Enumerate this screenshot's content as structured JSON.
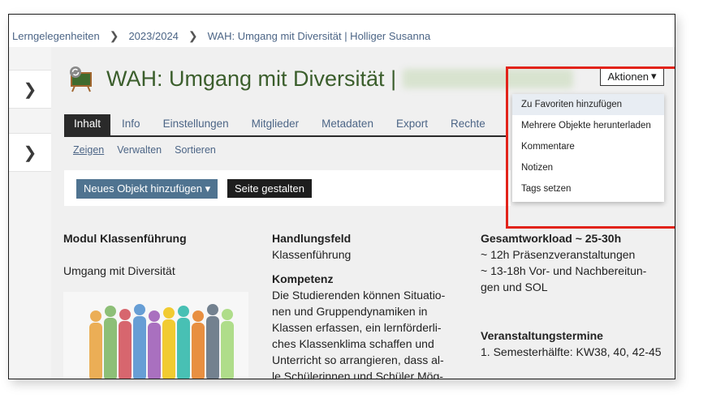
{
  "breadcrumb": {
    "items": [
      "Lerngelegenheiten",
      "2023/2024",
      "WAH: Umgang mit Diversität | Holliger Susanna"
    ]
  },
  "header": {
    "title": "WAH: Umgang mit Diversität |",
    "actions_label": "Aktionen"
  },
  "tabs": [
    "Inhalt",
    "Info",
    "Einstellungen",
    "Mitglieder",
    "Metadaten",
    "Export",
    "Rechte"
  ],
  "subtabs": [
    "Zeigen",
    "Verwalten",
    "Sortieren"
  ],
  "toolbar": {
    "add_object": "Neues Objekt hinzufügen",
    "design_page": "Seite gestalten"
  },
  "actions_menu": {
    "items": [
      "Zu Favoriten hinzufügen",
      "Mehrere Objekte herunterladen",
      "Kommentare",
      "Notizen",
      "Tags setzen"
    ]
  },
  "content": {
    "col1": {
      "heading": "Modul Klassenführung",
      "text": "Umgang mit Diversität"
    },
    "col2": {
      "heading1": "Handlungsfeld",
      "text1": "Klassenführung",
      "heading2": "Kompetenz",
      "lines": [
        "Die Studierenden können Situatio-",
        "nen und Gruppendynamiken in",
        "Klassen erfassen, ein lernförderli-",
        "ches Klassenklima schaffen und",
        "Unterricht so arrangieren, dass al-",
        "le Schülerinnen und Schüler Mög-"
      ]
    },
    "col3": {
      "heading1": "Gesamtworkload ~ 25-30h",
      "lines1": [
        "~ 12h Präsenzveranstaltungen",
        "~ 13-18h Vor- und Nachbereitun-",
        "gen und SOL"
      ],
      "heading2": "Veranstaltungstermine",
      "text2": "1. Semesterhälfte: KW38, 40, 42-45"
    }
  },
  "colors": {
    "link": "#4c6586",
    "title": "#3b5e2c",
    "highlight": "#e2231a"
  }
}
